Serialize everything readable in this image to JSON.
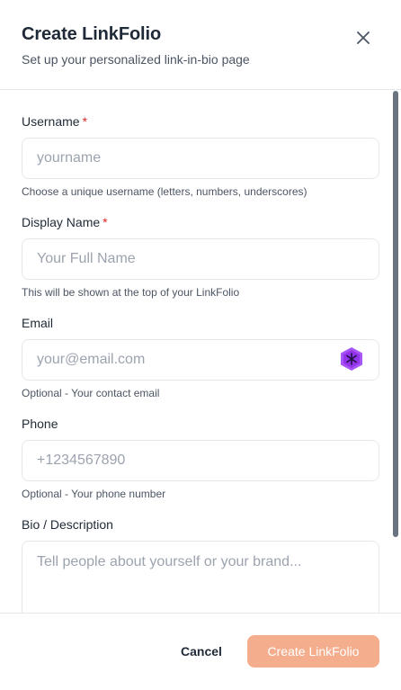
{
  "header": {
    "title": "Create LinkFolio",
    "subtitle": "Set up your personalized link-in-bio page"
  },
  "form": {
    "username": {
      "label": "Username",
      "required_mark": "*",
      "placeholder": "yourname",
      "value": "",
      "hint": "Choose a unique username (letters, numbers, underscores)"
    },
    "display_name": {
      "label": "Display Name",
      "required_mark": "*",
      "placeholder": "Your Full Name",
      "value": "",
      "hint": "This will be shown at the top of your LinkFolio"
    },
    "email": {
      "label": "Email",
      "placeholder": "your@email.com",
      "value": "",
      "hint": "Optional - Your contact email",
      "extension_icon": "password-manager-icon"
    },
    "phone": {
      "label": "Phone",
      "placeholder": "+1234567890",
      "value": "",
      "hint": "Optional - Your phone number"
    },
    "bio": {
      "label": "Bio / Description",
      "placeholder": "Tell people about yourself or your brand...",
      "value": ""
    }
  },
  "footer": {
    "cancel_label": "Cancel",
    "create_label": "Create LinkFolio"
  },
  "colors": {
    "required": "#dc2626",
    "primary_disabled": "#f4ae8e",
    "extension_icon": "#a855f7"
  }
}
